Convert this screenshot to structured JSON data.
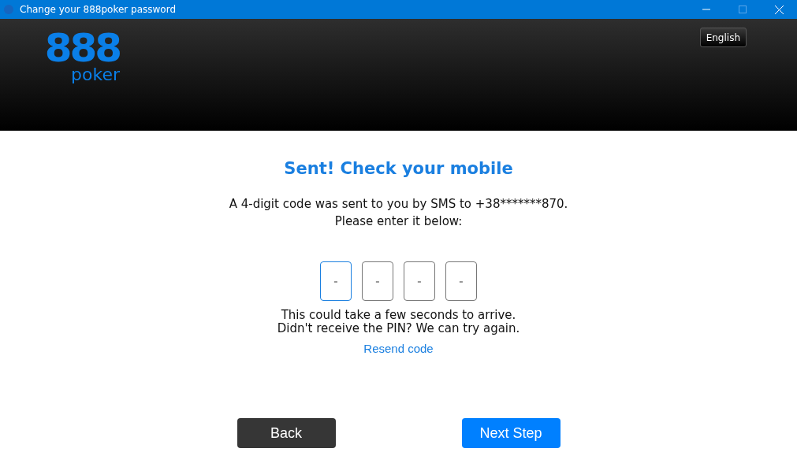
{
  "window": {
    "title": "Change your 888poker password"
  },
  "header": {
    "logo": {
      "digits": "888",
      "word": "poker"
    },
    "language": "English"
  },
  "heading": "Sent! Check your mobile",
  "message": [
    "A 4-digit code was sent to you by SMS to +38*******870.",
    "Please enter it below:"
  ],
  "pin_fields": [
    {
      "placeholder": "-",
      "selected": true
    },
    {
      "placeholder": "-",
      "selected": false
    },
    {
      "placeholder": "-",
      "selected": false
    },
    {
      "placeholder": "-",
      "selected": false
    }
  ],
  "hint": [
    "This could take a few seconds to arrive.",
    "Didn't receive the PIN? We can try again."
  ],
  "resend_link": "Resend code",
  "buttons": [
    {
      "label": "Back",
      "kind": "secondary"
    },
    {
      "label": "Next Step",
      "kind": "primary"
    }
  ]
}
